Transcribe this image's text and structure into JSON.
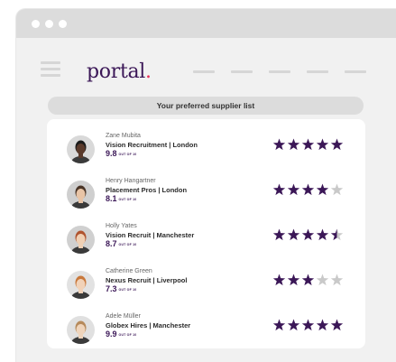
{
  "app": {
    "logo_text": "portal",
    "logo_dot": ".",
    "nav_placeholder_count": 5
  },
  "list": {
    "title": "Your preferred supplier list",
    "items": [
      {
        "name": "Zane Mubita",
        "company": "Vision Recruitment | London",
        "score": "9.8",
        "out_of": "OUT OF 10",
        "rating": 5,
        "avatar_skin": "#5a3a2b",
        "avatar_hair": "#1b1b1b",
        "avatar_bg": "#d9d9d9"
      },
      {
        "name": "Henry Hangartner",
        "company": "Placement Pros | London",
        "score": "8.1",
        "out_of": "OUT OF 10",
        "rating": 4,
        "avatar_skin": "#e8c4a6",
        "avatar_hair": "#4a3527",
        "avatar_bg": "#cfcfcf"
      },
      {
        "name": "Holly Yates",
        "company": "Vision Recruit | Manchester",
        "score": "8.7",
        "out_of": "OUT OF 10",
        "rating": 4.5,
        "avatar_skin": "#f0d0b4",
        "avatar_hair": "#b0542f",
        "avatar_bg": "#d0d0d0"
      },
      {
        "name": "Catherine Green",
        "company": "Nexus Recruit | Liverpool",
        "score": "7.3",
        "out_of": "OUT OF 10",
        "rating": 3,
        "avatar_skin": "#f1d2b8",
        "avatar_hair": "#c9793c",
        "avatar_bg": "#e2e2e2"
      },
      {
        "name": "Adele Müller",
        "company": "Globex Hires | Manchester",
        "score": "9.9",
        "out_of": "OUT OF 10",
        "rating": 5,
        "avatar_skin": "#efd4bb",
        "avatar_hair": "#b68a5b",
        "avatar_bg": "#e0e0e0"
      }
    ]
  },
  "colors": {
    "star_filled": "#3b1757",
    "star_empty": "#c9c9c9",
    "brand": "#3b1757",
    "accent_dot": "#e8325a"
  }
}
